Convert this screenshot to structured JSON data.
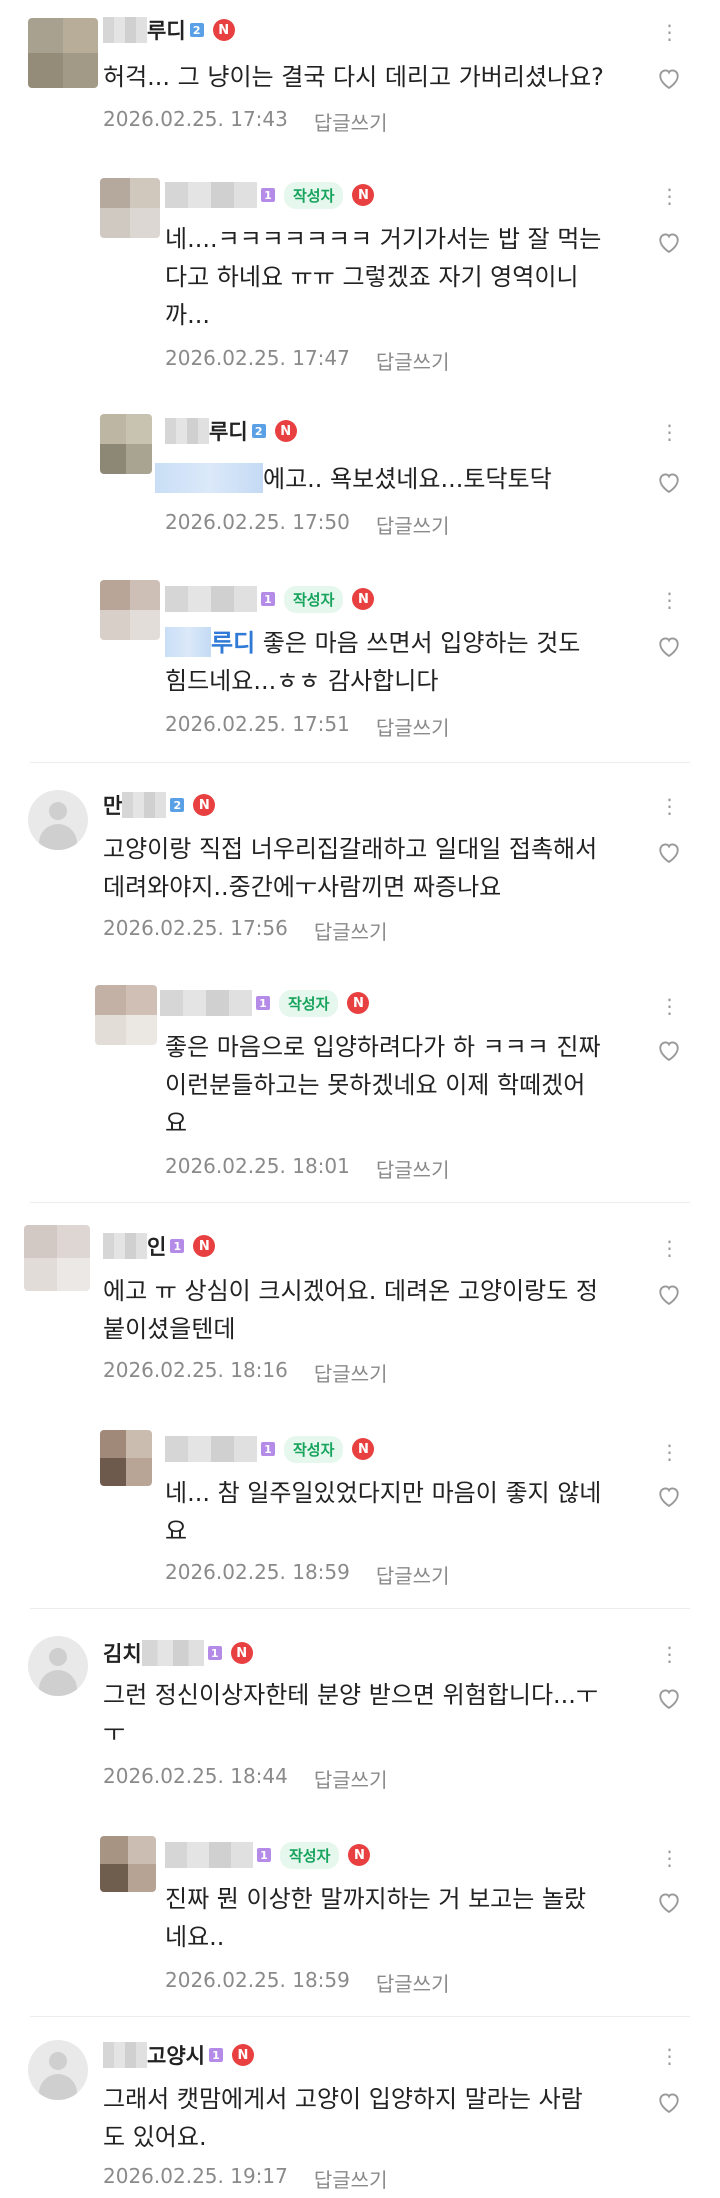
{
  "colors": {
    "author_badge_text": "#16a35c",
    "author_badge_bg": "#e6f7ee",
    "new_badge": "#e84040",
    "mention": "#2f7ad6",
    "meta": "#8a8a8a"
  },
  "icons": {
    "more": "more-vertical-icon",
    "like": "heart-outline-icon",
    "new": "new-badge-icon"
  },
  "labels": {
    "reply": "답글쓰기",
    "author": "작성자",
    "new_badge": "N"
  },
  "comments": [
    {
      "name": "루디",
      "level": "2",
      "text": "허걱... 그 냥이는 결국 다시 데리고 가버리셨나요?",
      "date": "2026.02.25. 17:43"
    },
    {
      "name": "",
      "level": "1",
      "text": "네....ㅋㅋㅋㅋㅋㅋㅋ 거기가서는 밥 잘 먹는\n다고 하네요 ㅠㅠ 그렇겠죠 자기 영역이니\n까...",
      "date": "2026.02.25. 17:47"
    },
    {
      "name": "루디",
      "level": "2",
      "text": "에고.. 욕보셨네요...토닥토닥",
      "date": "2026.02.25. 17:50"
    },
    {
      "name": "",
      "level": "1",
      "mention": "루디",
      "text": " 좋은 마음 쓰면서 입양하는 것도\n힘드네요...ㅎㅎ 감사합니다",
      "date": "2026.02.25. 17:51"
    },
    {
      "name": "만",
      "level": "2",
      "text": "고양이랑 직접 너우리집갈래하고 일대일 접촉해서\n데려와야지..중간에ㅜ사람끼면 짜증나요",
      "date": "2026.02.25. 17:56"
    },
    {
      "name": "",
      "level": "1",
      "text": "좋은 마음으로 입양하려다가 하 ㅋㅋㅋ 진짜\n이런분들하고는 못하겠네요 이제 학떼겠어\n요",
      "date": "2026.02.25. 18:01"
    },
    {
      "name": "인",
      "level": "1",
      "text": "에고 ㅠ 상심이 크시겠어요. 데려온 고양이랑도 정\n붙이셨을텐데",
      "date": "2026.02.25. 18:16"
    },
    {
      "name": "",
      "level": "1",
      "text": "네... 참 일주일있었다지만 마음이 좋지 않네\n요",
      "date": "2026.02.25. 18:59"
    },
    {
      "name": "김치",
      "level": "1",
      "text": "그런 정신이상자한테 분양 받으면 위험합니다...ㅜ\nㅜ",
      "date": "2026.02.25. 18:44"
    },
    {
      "name": "",
      "level": "1",
      "text": "진짜 뭔 이상한 말까지하는 거 보고는 놀랐\n네요..",
      "date": "2026.02.25. 18:59"
    },
    {
      "name": "고양시",
      "level": "1",
      "text": "그래서 캣맘에게서 고양이 입양하지 말라는 사람\n도 있어요.",
      "date": "2026.02.25. 19:17"
    }
  ]
}
